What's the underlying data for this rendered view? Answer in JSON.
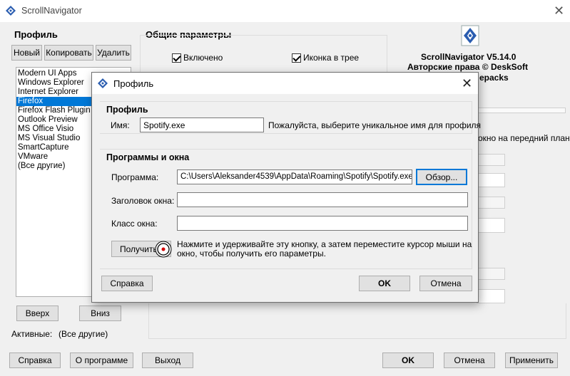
{
  "app": {
    "title": "ScrollNavigator",
    "close_glyph": "✕"
  },
  "profile_panel": {
    "title": "Профиль",
    "buttons": {
      "new": "Новый",
      "copy": "Копировать",
      "delete": "Удалить"
    },
    "list": [
      "Modern UI Apps",
      "Windows Explorer",
      "Internet Explorer",
      "Firefox",
      "Firefox Flash Plugin",
      "Outlook Preview",
      "MS Office Visio",
      "MS Visual Studio",
      "SmartCapture",
      "VMware",
      "(Все другие)"
    ],
    "selected_index": 3,
    "up": "Вверх",
    "down": "Вниз",
    "active_label": "Активные:",
    "active_value": "(Все другие)"
  },
  "general": {
    "title": "Общие параметры",
    "enabled": "Включено",
    "tray_icon": "Иконка в трее",
    "bring_front_partial": "окно на передний план"
  },
  "about": {
    "version": "ScrollNavigator V5.14.0",
    "copyright": "Авторские права © DeskSoft",
    "partial": "epacks"
  },
  "bottom": {
    "help": "Справка",
    "about": "О программе",
    "exit": "Выход",
    "ok": "OK",
    "cancel": "Отмена",
    "apply": "Применить"
  },
  "dialog": {
    "title": "Профиль",
    "close_glyph": "✕",
    "profile_group": "Профиль",
    "name_label": "Имя:",
    "name_value": "Spotify.exe",
    "name_hint": "Пожалуйста, выберите уникальное имя для профиля",
    "programs_group": "Программы и окна",
    "program_label": "Программа:",
    "program_value": "C:\\Users\\Aleksander4539\\AppData\\Roaming\\Spotify\\Spotify.exe",
    "browse": "Обзор...",
    "window_title_label": "Заголовок окна:",
    "window_title_value": "",
    "window_class_label": "Класс окна:",
    "window_class_value": "",
    "get_button": "Получить",
    "get_hint_line1": "Нажмите и удерживайте эту кнопку, а затем переместите курсор мыши на",
    "get_hint_line2": "окно, чтобы получить его параметры.",
    "help": "Справка",
    "ok": "OK",
    "cancel": "Отмена"
  },
  "colors": {
    "accent": "#0078d7",
    "window_bg": "#f0f0f0",
    "target_red": "#d40000"
  }
}
